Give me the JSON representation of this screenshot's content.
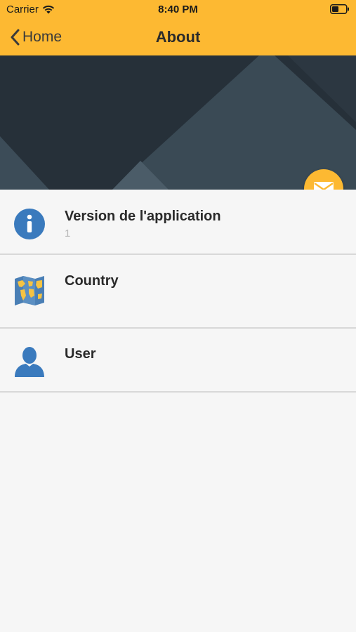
{
  "status_bar": {
    "carrier": "Carrier",
    "time": "8:40 PM"
  },
  "nav": {
    "back_label": "Home",
    "title": "About"
  },
  "colors": {
    "accent": "#fdb932",
    "hero_dark": "#263039",
    "info_blue": "#3a7abd"
  },
  "fab": {
    "icon": "mail-icon"
  },
  "items": [
    {
      "title": "Version de l'application",
      "subtitle": "1",
      "icon": "info-icon"
    },
    {
      "title": "Country",
      "icon": "map-icon"
    },
    {
      "title": "User",
      "icon": "user-icon"
    }
  ]
}
